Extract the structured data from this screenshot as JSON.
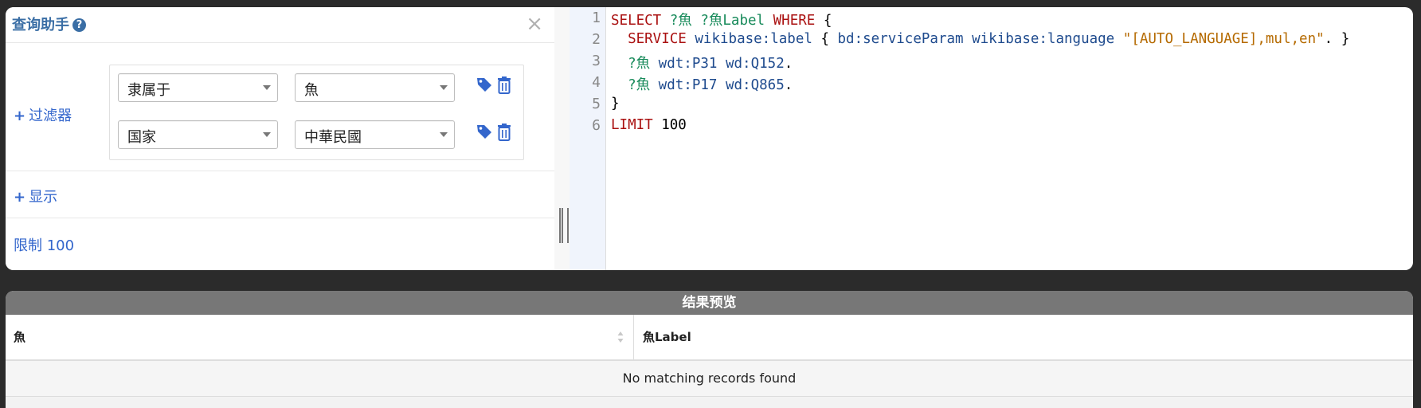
{
  "helper": {
    "title": "查询助手",
    "help_glyph": "?",
    "close_glyph": "×",
    "filter_label": "过滤器",
    "display_label": "显示",
    "limit_label": "限制 100",
    "plus": "+",
    "filters": [
      {
        "property": "隶属于",
        "value": "魚"
      },
      {
        "property": "国家",
        "value": "中華民國"
      }
    ]
  },
  "editor": {
    "line_numbers": [
      "1",
      "2",
      "3",
      "4",
      "5",
      "6"
    ],
    "lines": [
      [
        {
          "t": "SELECT",
          "c": "kw"
        },
        {
          "t": " "
        },
        {
          "t": "?魚",
          "c": "var"
        },
        {
          "t": " "
        },
        {
          "t": "?魚Label",
          "c": "var"
        },
        {
          "t": " "
        },
        {
          "t": "WHERE",
          "c": "kw"
        },
        {
          "t": " {"
        }
      ],
      [
        {
          "t": "  "
        },
        {
          "t": "SERVICE",
          "c": "kw"
        },
        {
          "t": " "
        },
        {
          "t": "wikibase:label",
          "c": "uri"
        },
        {
          "t": " { "
        },
        {
          "t": "bd:serviceParam",
          "c": "uri"
        },
        {
          "t": " "
        },
        {
          "t": "wikibase:language",
          "c": "uri"
        },
        {
          "t": " "
        },
        {
          "t": "\"[AUTO_LANGUAGE],mul,en\"",
          "c": "str"
        },
        {
          "t": ". }"
        }
      ],
      [
        {
          "t": "  "
        },
        {
          "t": "?魚",
          "c": "var"
        },
        {
          "t": " "
        },
        {
          "t": "wdt:P31",
          "c": "uri"
        },
        {
          "t": " "
        },
        {
          "t": "wd:Q152",
          "c": "uri"
        },
        {
          "t": "."
        }
      ],
      [
        {
          "t": "  "
        },
        {
          "t": "?魚",
          "c": "var"
        },
        {
          "t": " "
        },
        {
          "t": "wdt:P17",
          "c": "uri"
        },
        {
          "t": " "
        },
        {
          "t": "wd:Q865",
          "c": "uri"
        },
        {
          "t": "."
        }
      ],
      [
        {
          "t": "}"
        }
      ],
      [
        {
          "t": "LIMIT",
          "c": "kw"
        },
        {
          "t": " 100"
        }
      ]
    ]
  },
  "results": {
    "title": "结果预览",
    "columns": [
      "魚",
      "魚Label"
    ],
    "empty_message": "No matching records found"
  },
  "colors": {
    "accent": "#3366cc",
    "keyword": "#aa1111",
    "variable": "#178a5a",
    "uri": "#1f4b8e",
    "string": "#b56a00"
  }
}
